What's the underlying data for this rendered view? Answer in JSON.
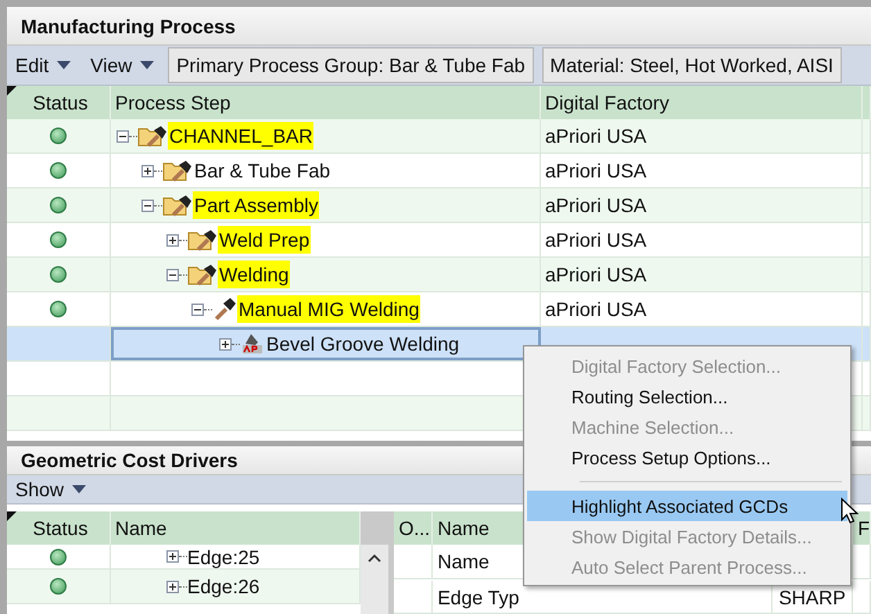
{
  "manufacturing_process": {
    "title": "Manufacturing Process",
    "menus": [
      "Edit",
      "View"
    ],
    "toolbar_fields": [
      "Primary Process Group: Bar & Tube Fab",
      "Material: Steel, Hot Worked, AISI"
    ],
    "columns": [
      "Status",
      "Process Step",
      "Digital Factory"
    ],
    "tree": [
      {
        "label": "CHANNEL_BAR",
        "kind": "group",
        "status_ok": true,
        "highlighted": true,
        "expanded": true,
        "selected": false,
        "factory": "aPriori USA",
        "children": [
          {
            "label": "Bar & Tube Fab",
            "kind": "group",
            "status_ok": true,
            "highlighted": false,
            "expanded": false,
            "selected": false,
            "factory": "aPriori USA"
          },
          {
            "label": "Part Assembly",
            "kind": "group",
            "status_ok": true,
            "highlighted": true,
            "expanded": true,
            "selected": false,
            "factory": "aPriori USA",
            "children": [
              {
                "label": "Weld Prep",
                "kind": "group",
                "status_ok": true,
                "highlighted": true,
                "expanded": false,
                "selected": false,
                "factory": "aPriori USA"
              },
              {
                "label": "Welding",
                "kind": "group",
                "status_ok": true,
                "highlighted": true,
                "expanded": true,
                "selected": false,
                "factory": "aPriori USA",
                "children": [
                  {
                    "label": "Manual MIG Welding",
                    "kind": "process",
                    "status_ok": true,
                    "highlighted": true,
                    "expanded": true,
                    "selected": false,
                    "factory": "aPriori USA",
                    "children": [
                      {
                        "label": "Bevel Groove Welding",
                        "kind": "operation",
                        "status_ok": false,
                        "highlighted": false,
                        "expanded": false,
                        "selected": true
                      }
                    ]
                  }
                ]
              }
            ]
          }
        ]
      }
    ]
  },
  "geometric_cost_drivers": {
    "title": "Geometric Cost Drivers",
    "menus": [
      "Show"
    ],
    "columns": [
      "Status",
      "Name"
    ],
    "rows": [
      {
        "status_ok": true,
        "name": "Edge:25",
        "expanded": false
      },
      {
        "status_ok": true,
        "name": "Edge:26",
        "expanded": false
      }
    ],
    "detail_columns": [
      "O...",
      "Name",
      "F"
    ],
    "detail_rows": [
      {
        "name": "Name"
      },
      {
        "name": "Edge Typ",
        "value": "SHARP"
      }
    ]
  },
  "context_menu": {
    "items": [
      {
        "kind": "item",
        "label": "Digital Factory Selection...",
        "disabled": true,
        "selected": false
      },
      {
        "kind": "item",
        "label": "Routing Selection...",
        "disabled": false,
        "selected": false
      },
      {
        "kind": "item",
        "label": "Machine Selection...",
        "disabled": true,
        "selected": false
      },
      {
        "kind": "item",
        "label": "Process Setup Options...",
        "disabled": false,
        "selected": false
      },
      {
        "kind": "separator"
      },
      {
        "kind": "item",
        "label": "Highlight Associated GCDs",
        "disabled": false,
        "selected": true
      },
      {
        "kind": "item",
        "label": "Show Digital Factory Details...",
        "disabled": true,
        "selected": false
      },
      {
        "kind": "item",
        "label": "Auto Select Parent Process...",
        "disabled": true,
        "selected": false
      }
    ]
  }
}
